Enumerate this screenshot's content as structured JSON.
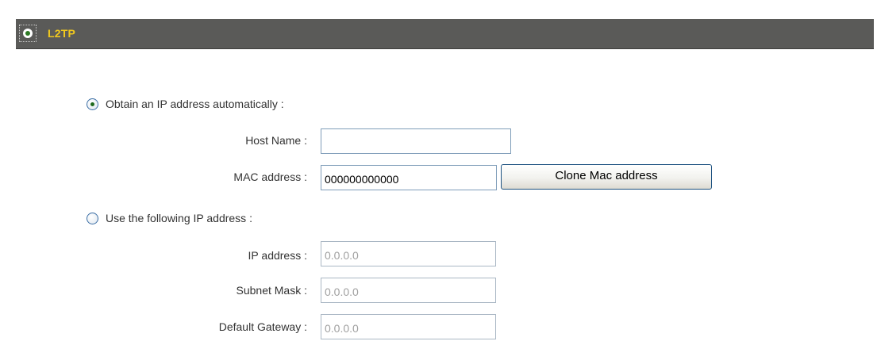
{
  "section": {
    "title": "L2TP",
    "selected": true
  },
  "auto_ip": {
    "label": "Obtain an IP address automatically :",
    "selected": true,
    "host_name": {
      "label": "Host Name :",
      "value": ""
    },
    "mac_address": {
      "label": "MAC address :",
      "value": "000000000000"
    },
    "clone_button_label": "Clone Mac address"
  },
  "static_ip": {
    "label": "Use the following IP address :",
    "selected": false,
    "ip_address": {
      "label": "IP address :",
      "value": "0.0.0.0"
    },
    "subnet_mask": {
      "label": "Subnet Mask :",
      "value": "0.0.0.0"
    },
    "default_gateway": {
      "label": "Default Gateway :",
      "value": "0.0.0.0"
    }
  }
}
